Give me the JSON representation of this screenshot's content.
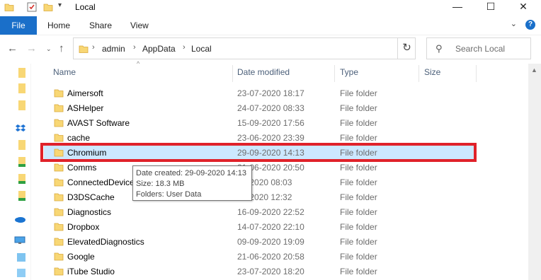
{
  "window": {
    "title": "Local",
    "controls": {
      "minimize": "—",
      "maximize": "☐",
      "close": "✕"
    }
  },
  "ribbon": {
    "file": "File",
    "tabs": [
      "Home",
      "Share",
      "View"
    ],
    "help": "?"
  },
  "address": {
    "crumbs": [
      "admin",
      "AppData",
      "Local"
    ]
  },
  "search": {
    "placeholder": "Search Local"
  },
  "columns": {
    "name": "Name",
    "date": "Date modified",
    "type": "Type",
    "size": "Size"
  },
  "rows": [
    {
      "name": "Aimersoft",
      "date": "23-07-2020 18:17",
      "type": "File folder"
    },
    {
      "name": "ASHelper",
      "date": "24-07-2020 08:33",
      "type": "File folder"
    },
    {
      "name": "AVAST Software",
      "date": "15-09-2020 17:56",
      "type": "File folder"
    },
    {
      "name": "cache",
      "date": "23-06-2020 23:39",
      "type": "File folder"
    },
    {
      "name": "Chromium",
      "date": "29-09-2020 14:13",
      "type": "File folder"
    },
    {
      "name": "Comms",
      "date": "21-06-2020 20:50",
      "type": "File folder"
    },
    {
      "name": "ConnectedDevice",
      "date": "16-2020 08:03",
      "type": "File folder"
    },
    {
      "name": "D3DSCache",
      "date": "07-2020 12:32",
      "type": "File folder"
    },
    {
      "name": "Diagnostics",
      "date": "16-09-2020 22:52",
      "type": "File folder"
    },
    {
      "name": "Dropbox",
      "date": "14-07-2020 22:10",
      "type": "File folder"
    },
    {
      "name": "ElevatedDiagnostics",
      "date": "09-09-2020 19:09",
      "type": "File folder"
    },
    {
      "name": "Google",
      "date": "21-06-2020 20:58",
      "type": "File folder"
    },
    {
      "name": "iTube Studio",
      "date": "23-07-2020 18:20",
      "type": "File folder"
    }
  ],
  "tooltip": {
    "created": "Date created: 29-09-2020 14:13",
    "size": "Size: 18.3 MB",
    "folders": "Folders: User Data"
  },
  "colors": {
    "accent": "#1a6fc9",
    "selection": "#cce8ff",
    "highlight": "#e0222a",
    "folder": "#f8d775"
  }
}
